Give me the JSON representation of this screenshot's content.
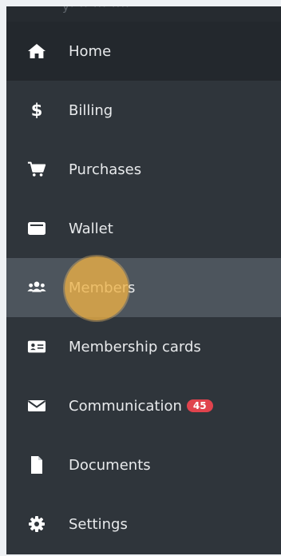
{
  "sidebar": {
    "items": [
      {
        "label": "Home",
        "icon": "home-icon"
      },
      {
        "label": "Billing",
        "icon": "dollar-icon"
      },
      {
        "label": "Purchases",
        "icon": "cart-icon"
      },
      {
        "label": "Wallet",
        "icon": "wallet-icon"
      },
      {
        "label": "Members",
        "icon": "users-icon",
        "active": true
      },
      {
        "label": "Membership cards",
        "icon": "id-card-icon"
      },
      {
        "label": "Communication",
        "icon": "envelope-icon",
        "badge": "45"
      },
      {
        "label": "Documents",
        "icon": "document-icon"
      },
      {
        "label": "Settings",
        "icon": "gear-icon"
      }
    ]
  },
  "colors": {
    "sidebar_bg": "#2f353b",
    "home_bg": "#23282d",
    "active_bg": "#4d555d",
    "badge_bg": "#e0434d",
    "click_highlight": "#eeb246"
  }
}
